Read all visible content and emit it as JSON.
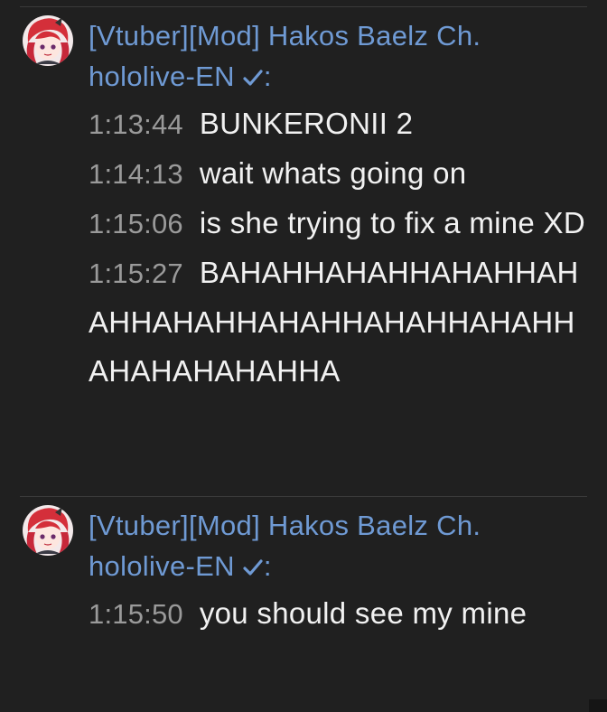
{
  "messages": [
    {
      "author": "[Vtuber][Mod] Hakos Baelz Ch. hololive-EN",
      "verified_icon": "checkmark-icon",
      "colon": ":",
      "lines": [
        {
          "time": "1:13:44",
          "text": "BUNKERONII 2"
        },
        {
          "time": "1:14:13",
          "text": "wait whats going on"
        },
        {
          "time": "1:15:06",
          "text": "is she trying to fix a mine XD"
        },
        {
          "time": "1:15:27",
          "text": "BAHAHHAHAHHAHAHHAHAHHAHAHHAHAHHAHAHHAHAHHAHAHAHAHAHHA"
        }
      ]
    },
    {
      "author": "[Vtuber][Mod] Hakos Baelz Ch. hololive-EN",
      "verified_icon": "checkmark-icon",
      "colon": ":",
      "lines": [
        {
          "time": "1:15:50",
          "text": "you should see my mine"
        }
      ]
    }
  ],
  "colors": {
    "background": "#202020",
    "author": "#6f9ad4",
    "timestamp": "#9a9a9a",
    "text": "#f1f1f1"
  }
}
